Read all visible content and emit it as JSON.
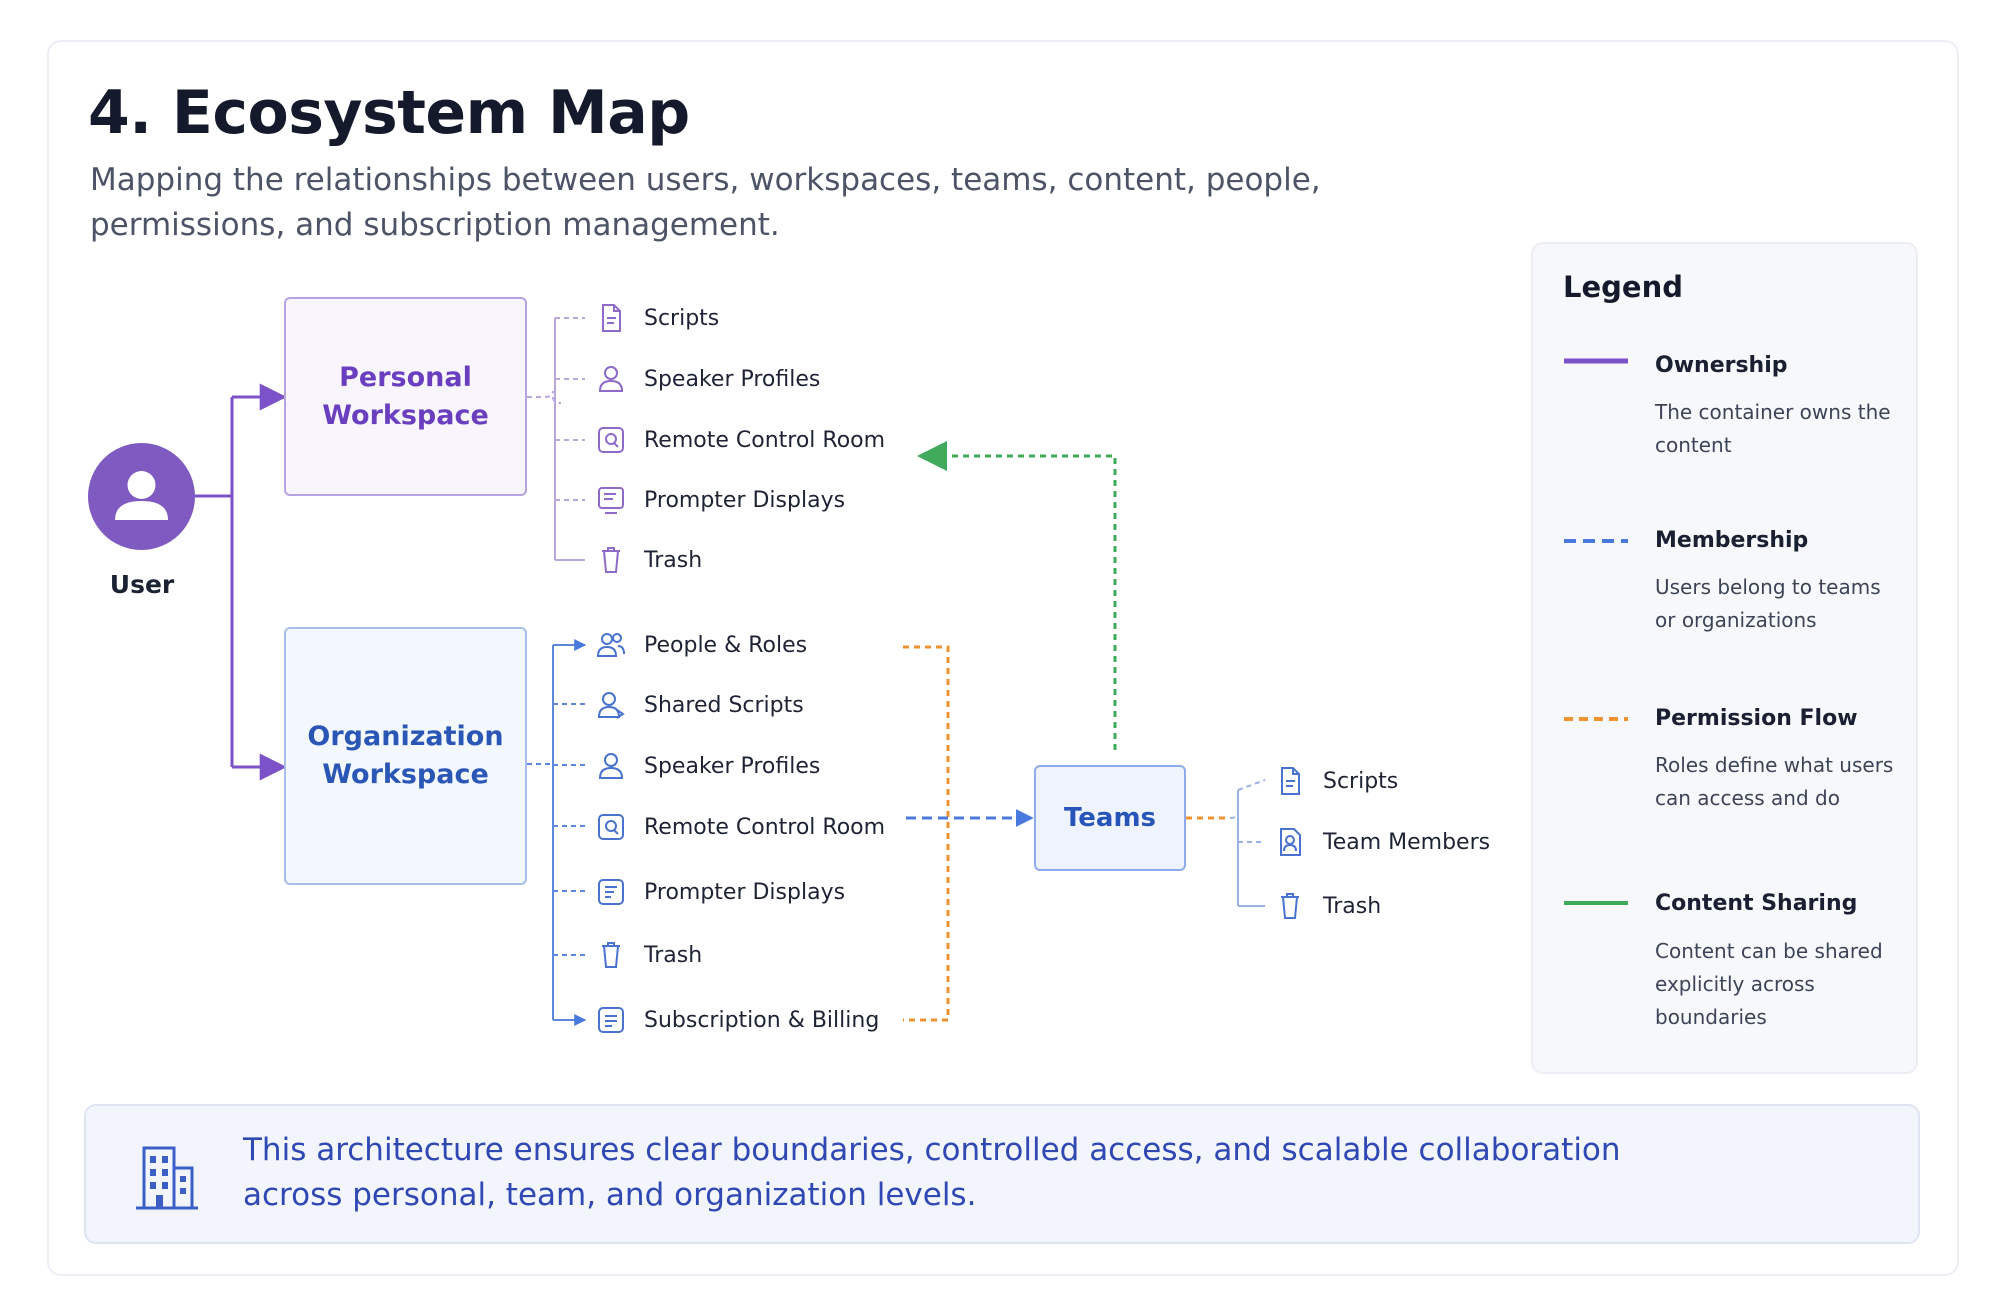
{
  "header": {
    "title": "4. Ecosystem Map",
    "subtitle": "Mapping the relationships between users, workspaces, teams, content, people, permissions, and subscription management."
  },
  "user": {
    "label": "User"
  },
  "personal_workspace": {
    "title_line1": "Personal",
    "title_line2": "Workspace",
    "items": [
      {
        "label": "Scripts",
        "icon": "document-icon"
      },
      {
        "label": "Speaker Profiles",
        "icon": "person-icon"
      },
      {
        "label": "Remote Control Room",
        "icon": "remote-icon"
      },
      {
        "label": "Prompter Displays",
        "icon": "display-icon"
      },
      {
        "label": "Trash",
        "icon": "trash-icon"
      }
    ]
  },
  "organization_workspace": {
    "title_line1": "Organization",
    "title_line2": "Workspace",
    "items": [
      {
        "label": "People & Roles",
        "icon": "people-icon"
      },
      {
        "label": "Shared Scripts",
        "icon": "shared-person-icon"
      },
      {
        "label": "Speaker Profiles",
        "icon": "person-icon"
      },
      {
        "label": "Remote Control Room",
        "icon": "remote-icon"
      },
      {
        "label": "Prompter Displays",
        "icon": "display-icon"
      },
      {
        "label": "Trash",
        "icon": "trash-icon"
      },
      {
        "label": "Subscription & Billing",
        "icon": "billing-icon"
      }
    ]
  },
  "teams": {
    "label": "Teams",
    "items": [
      {
        "label": "Scripts",
        "icon": "document-icon"
      },
      {
        "label": "Team Members",
        "icon": "member-card-icon"
      },
      {
        "label": "Trash",
        "icon": "trash-icon"
      }
    ]
  },
  "legend": {
    "title": "Legend",
    "entries": [
      {
        "name": "Ownership",
        "description": "The container owns the content",
        "color": "#7c52c9",
        "style": "solid"
      },
      {
        "name": "Membership",
        "description": "Users belong to teams or organizations",
        "color": "#4a79de",
        "style": "dashed"
      },
      {
        "name": "Permission Flow",
        "description": "Roles define what users can access and do",
        "color": "#f0922f",
        "style": "dashed"
      },
      {
        "name": "Content Sharing",
        "description": "Content can be shared explicitly across boundaries",
        "color": "#3eaa5a",
        "style": "solid"
      }
    ]
  },
  "footer": {
    "note": "This architecture ensures clear boundaries, controlled access, and scalable collaboration across personal, team, and organization levels.",
    "icon": "building-icon"
  },
  "colors": {
    "purple": "#7c52c9",
    "blue": "#4a79de",
    "orange": "#f0922f",
    "green": "#3eaa5a"
  }
}
